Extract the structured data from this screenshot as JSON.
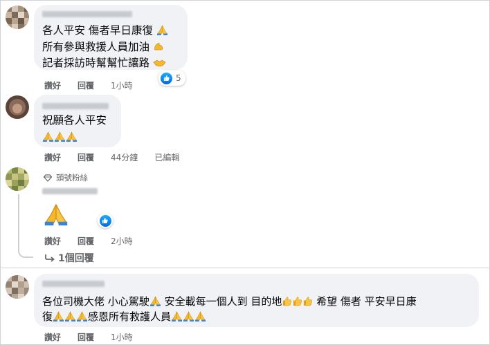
{
  "comments": [
    {
      "lines": [
        "各人平安 傷者早日康復",
        "所有參與救援人員加油",
        "記者採訪時幫幫忙讓路"
      ],
      "actions": {
        "like": "讚好",
        "reply": "回覆",
        "time": "1小時"
      },
      "reaction_count": "5"
    },
    {
      "lines": [
        "祝願各人平安"
      ],
      "actions": {
        "like": "讚好",
        "reply": "回覆",
        "time": "44分鐘",
        "edited": "已編輯"
      }
    },
    {
      "badge": "頭號粉絲",
      "actions": {
        "like": "讚好",
        "reply": "回覆",
        "time": "2小時"
      },
      "replies_link": "1個回覆"
    },
    {
      "line1_a": "各位司機大佬 小心駕駛",
      "line1_b": "安全載每一個人到 目的地",
      "line1_c": "希望 傷者 平安早日康",
      "line2_a": "復",
      "line2_b": "感恩所有救護人員",
      "actions": {
        "like": "讚好",
        "reply": "回覆",
        "time": "1小時"
      }
    }
  ],
  "colors": {
    "bubble": "#f0f2f5",
    "meta": "#65676b",
    "like_blue": "#1877f2",
    "pray_yellow": "#f5b72c"
  },
  "icons": [
    "pray-emoji-icon",
    "flexed-biceps-emoji-icon",
    "handshake-emoji-icon",
    "like-reaction-icon",
    "diamond-icon",
    "reply-arrow-icon",
    "thumbs-up-emoji-icon"
  ]
}
